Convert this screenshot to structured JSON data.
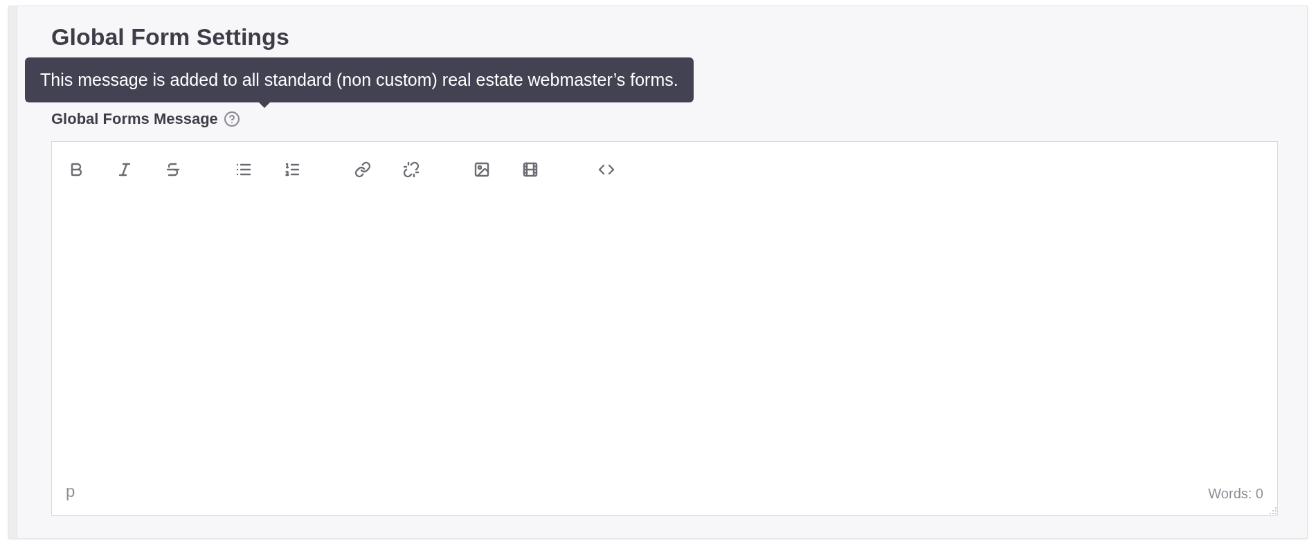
{
  "title": "Global Form Settings",
  "tooltip": "This message is added to all standard (non custom) real estate webmaster’s forms.",
  "field_label": "Global Forms Message",
  "editor": {
    "toolbar": [
      {
        "kind": "bold"
      },
      {
        "kind": "italic"
      },
      {
        "kind": "strikethrough"
      },
      {
        "kind": "bullet-list"
      },
      {
        "kind": "numbered-list"
      },
      {
        "kind": "link"
      },
      {
        "kind": "unlink"
      },
      {
        "kind": "image"
      },
      {
        "kind": "video"
      },
      {
        "kind": "code"
      }
    ],
    "path": "p",
    "word_count": "Words: 0"
  }
}
